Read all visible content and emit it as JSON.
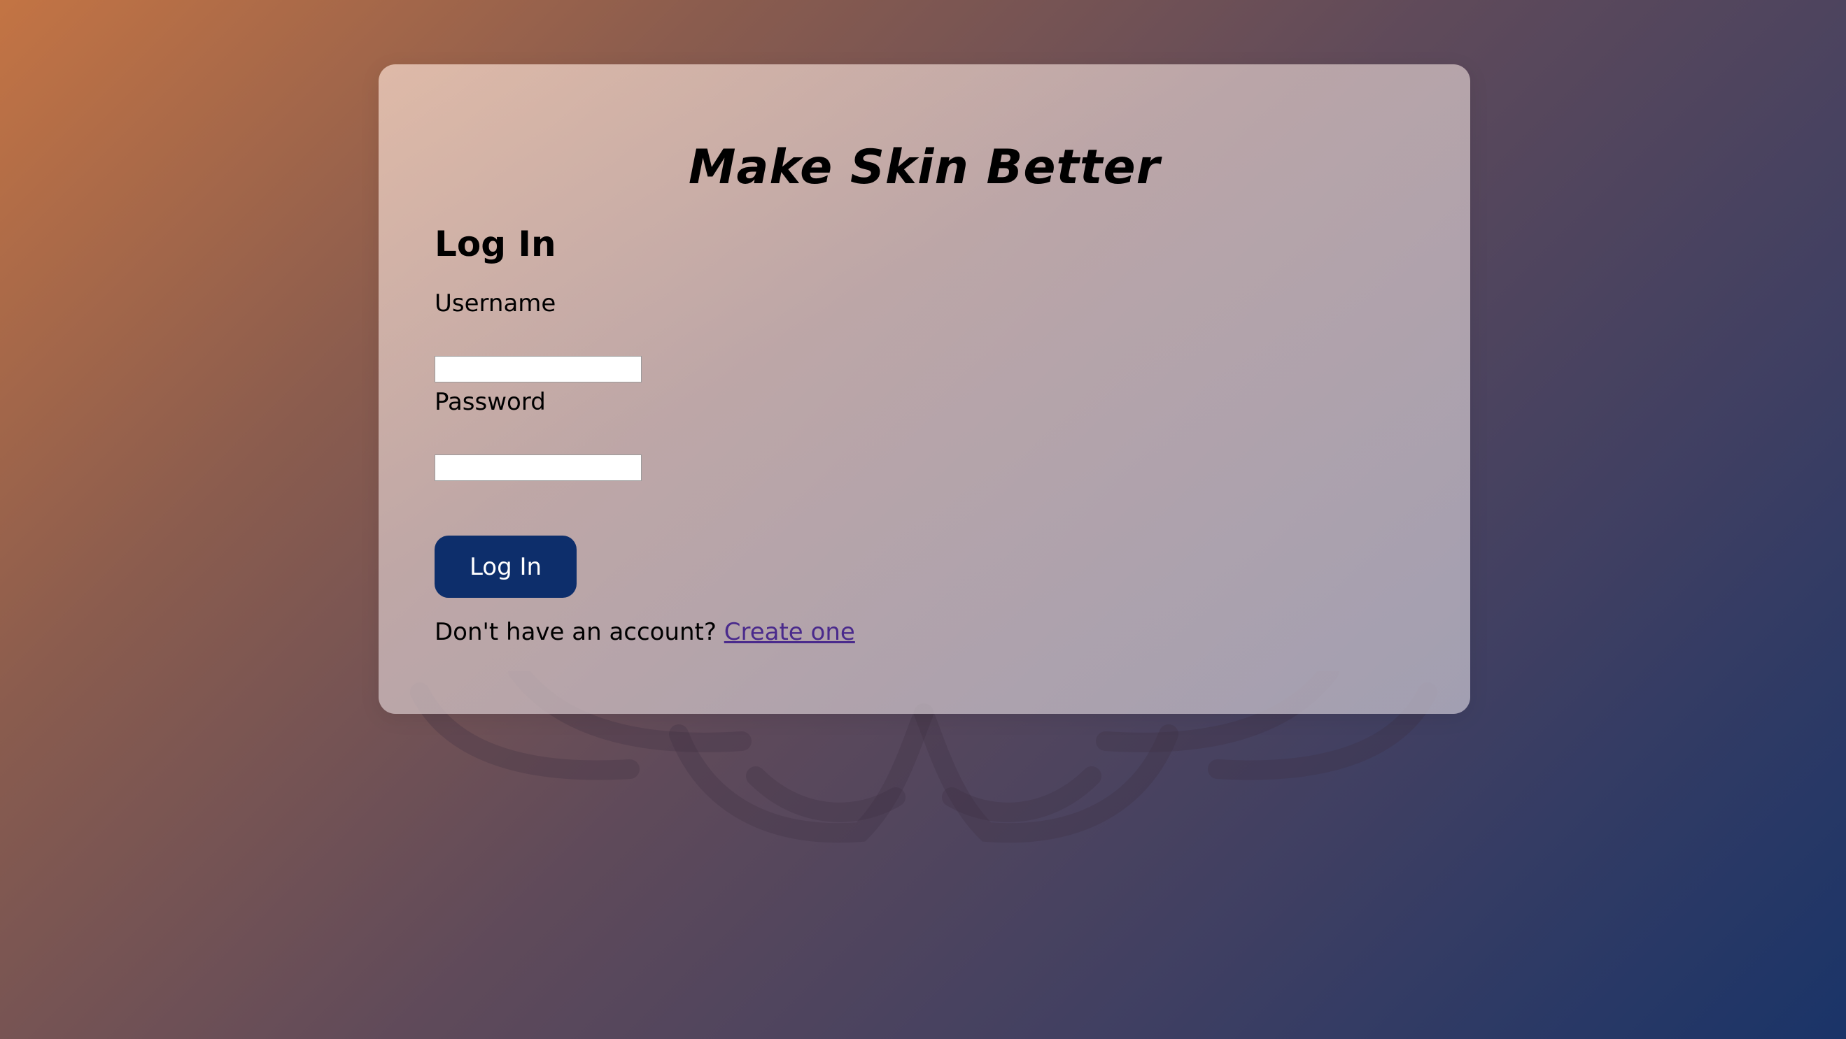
{
  "app": {
    "title": "Make Skin Better"
  },
  "login_form": {
    "heading": "Log In",
    "username_label": "Username",
    "username_value": "",
    "password_label": "Password",
    "password_value": "",
    "submit_label": "Log In",
    "signup_prompt": "Don't have an account?",
    "signup_link_label": "Create one"
  },
  "colors": {
    "background_start": "#c37444",
    "background_end": "#1a3468",
    "button_background": "#0d2e6b",
    "button_text": "#ffffff",
    "link": "#4a2a8c"
  },
  "icons": {
    "background_ornament": "lotus-ornament"
  }
}
